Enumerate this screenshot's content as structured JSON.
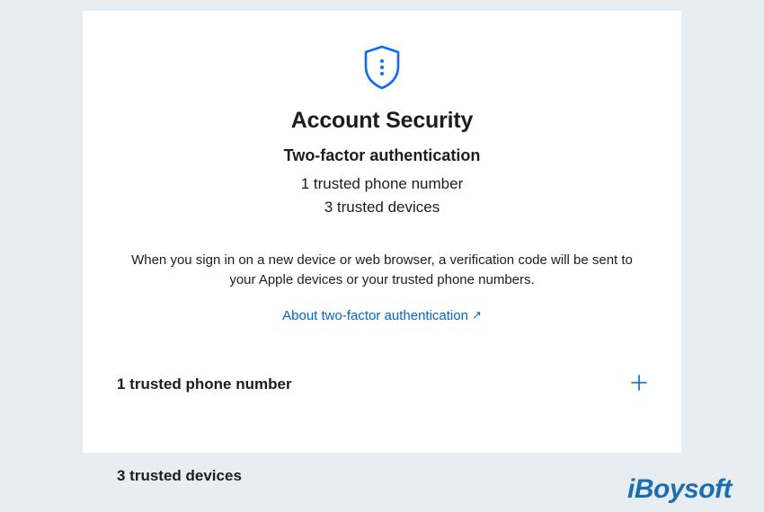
{
  "header": {
    "title": "Account Security",
    "subtitle": "Two-factor authentication",
    "trusted_phone_summary": "1 trusted phone number",
    "trusted_devices_summary": "3 trusted devices"
  },
  "description": "When you sign in on a new device or web browser, a verification code will be sent to your Apple devices or your trusted phone numbers.",
  "link": {
    "label": "About two-factor authentication",
    "arrow": "↗"
  },
  "sections": {
    "phone": {
      "label": "1 trusted phone number"
    },
    "devices": {
      "label": "3 trusted devices"
    }
  },
  "icons": {
    "shield": "shield-icon",
    "plus": "plus-icon"
  },
  "colors": {
    "accent": "#0066cc",
    "text": "#1d1d1f"
  },
  "watermark": "iBoysoft"
}
